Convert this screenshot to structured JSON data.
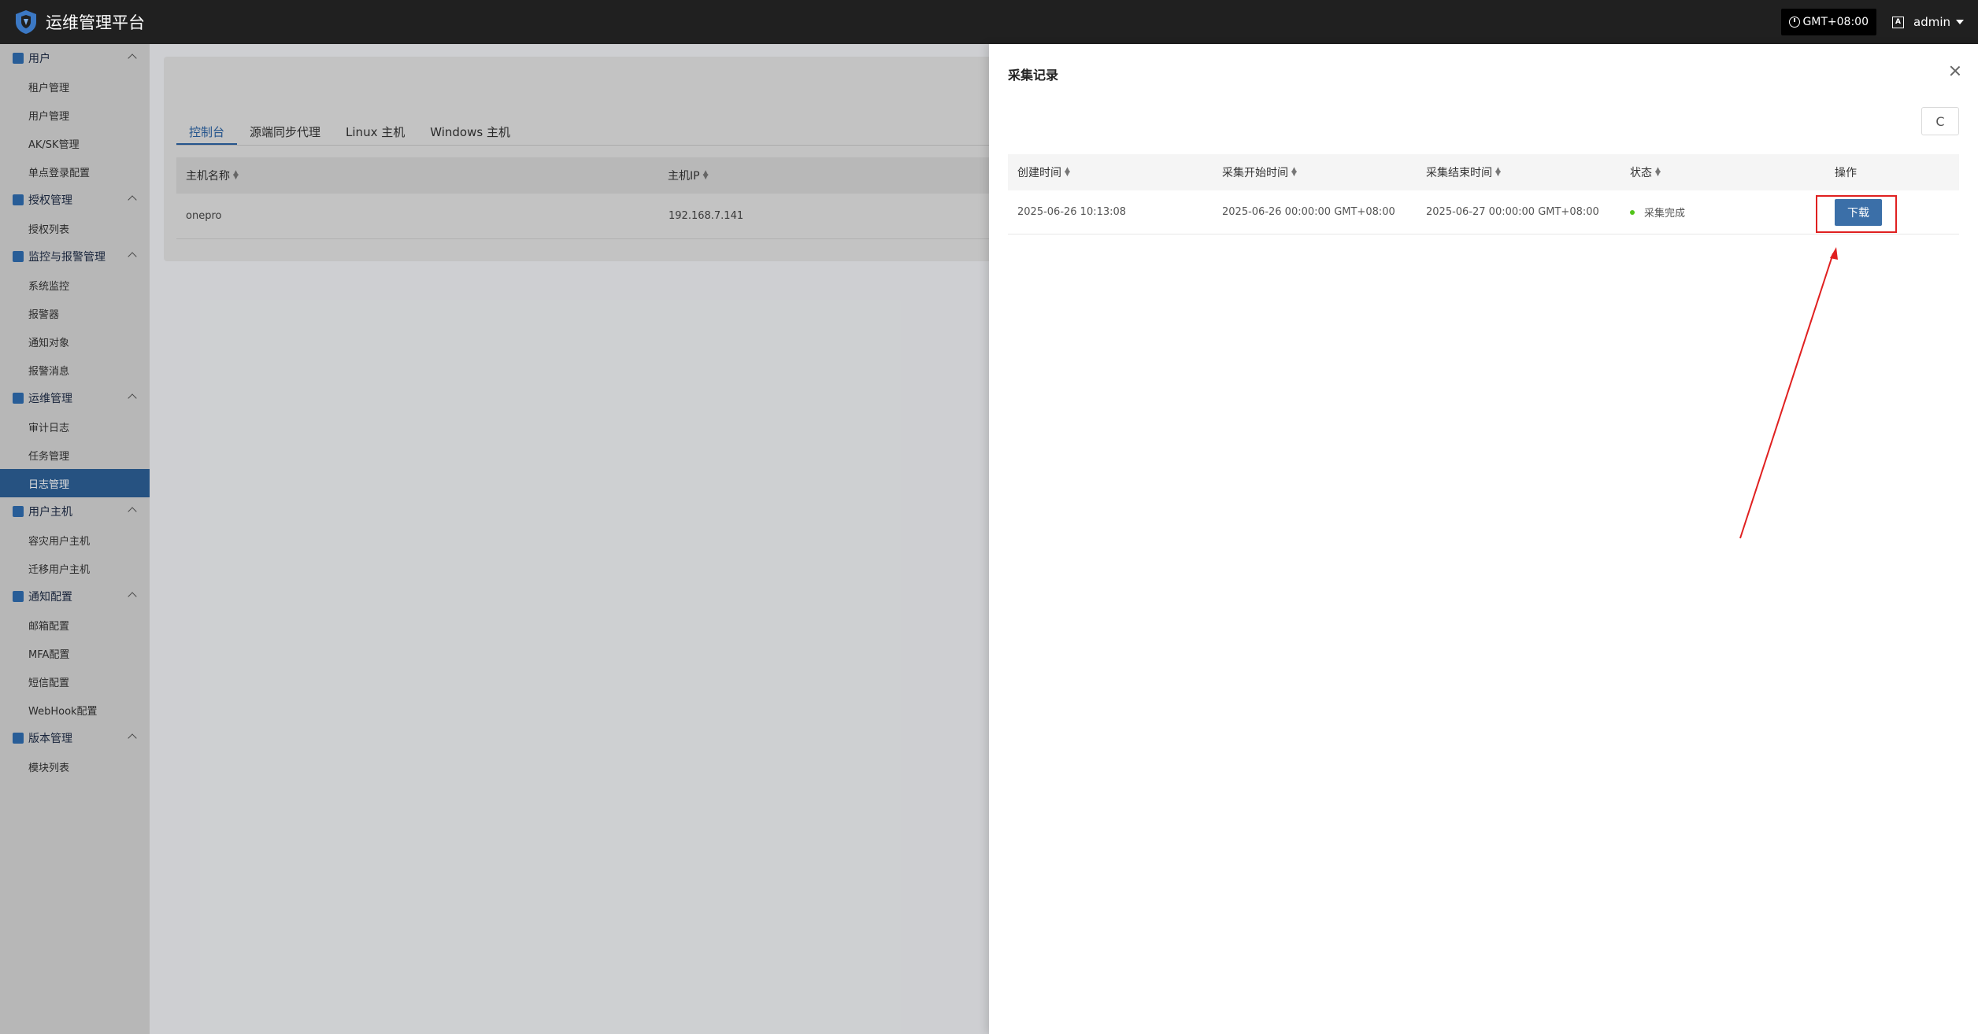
{
  "header": {
    "title": "运维管理平台",
    "timezone": "GMT+08:00",
    "user": "admin",
    "lang_icon_text": "A"
  },
  "sidebar": {
    "groups": [
      {
        "label": "用户",
        "icon": "user-icon",
        "items": [
          "租户管理",
          "用户管理",
          "AK/SK管理",
          "单点登录配置"
        ]
      },
      {
        "label": "授权管理",
        "icon": "key-icon",
        "items": [
          "授权列表"
        ]
      },
      {
        "label": "监控与报警管理",
        "icon": "alarm-icon",
        "items": [
          "系统监控",
          "报警器",
          "通知对象",
          "报警消息"
        ]
      },
      {
        "label": "运维管理",
        "icon": "tool-icon",
        "items": [
          "审计日志",
          "任务管理",
          "日志管理"
        ]
      },
      {
        "label": "用户主机",
        "icon": "layers-icon",
        "items": [
          "容灾用户主机",
          "迁移用户主机"
        ]
      },
      {
        "label": "通知配置",
        "icon": "gear-icon",
        "items": [
          "邮箱配置",
          "MFA配置",
          "短信配置",
          "WebHook配置"
        ]
      },
      {
        "label": "版本管理",
        "icon": "lock-icon",
        "items": [
          "模块列表"
        ]
      }
    ],
    "active_item": "日志管理"
  },
  "main": {
    "tabs": [
      "控制台",
      "源端同步代理",
      "Linux 主机",
      "Windows 主机"
    ],
    "active_tab": "控制台",
    "columns": [
      "主机名称",
      "主机IP"
    ],
    "rows": [
      {
        "name": "onepro",
        "ip": "192.168.7.141"
      }
    ]
  },
  "drawer": {
    "title": "采集记录",
    "columns": [
      "创建时间",
      "采集开始时间",
      "采集结束时间",
      "状态",
      "操作"
    ],
    "rows": [
      {
        "created": "2025-06-26 10:13:08",
        "start": "2025-06-26 00:00:00 GMT+08:00",
        "end": "2025-06-27 00:00:00 GMT+08:00",
        "status": "采集完成",
        "action": "下载"
      }
    ],
    "refresh_icon": "C",
    "status_color": "#52c41a",
    "accent": "#3b6fa8"
  }
}
